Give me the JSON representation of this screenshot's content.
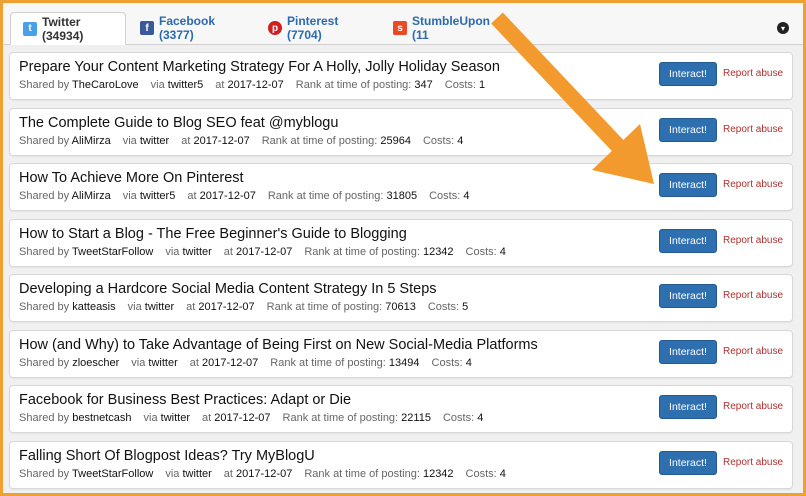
{
  "tabs": [
    {
      "label": "Twitter (34934)",
      "icon": "twitter-icon"
    },
    {
      "label": "Facebook (3377)",
      "icon": "facebook-icon"
    },
    {
      "label": "Pinterest (7704)",
      "icon": "pinterest-icon"
    },
    {
      "label": "StumbleUpon (11",
      "icon": "stumbleupon-icon"
    }
  ],
  "labels": {
    "shared_by": "Shared by",
    "via": "via",
    "at": "at",
    "rank": "Rank at time of posting:",
    "costs": "Costs:",
    "interact": "Interact!",
    "report": "Report abuse"
  },
  "rows": [
    {
      "title": "Prepare Your Content Marketing Strategy For A Holly, Jolly Holiday Season",
      "user": "TheCaroLove",
      "via": "twitter5",
      "date": "2017-12-07",
      "rank": "347",
      "cost": "1"
    },
    {
      "title": "The Complete Guide to Blog SEO feat @myblogu",
      "user": "AliMirza",
      "via": "twitter",
      "date": "2017-12-07",
      "rank": "25964",
      "cost": "4"
    },
    {
      "title": "How To Achieve More On Pinterest",
      "user": "AliMirza",
      "via": "twitter5",
      "date": "2017-12-07",
      "rank": "31805",
      "cost": "4"
    },
    {
      "title": "How to Start a Blog - The Free Beginner's Guide to Blogging",
      "user": "TweetStarFollow",
      "via": "twitter",
      "date": "2017-12-07",
      "rank": "12342",
      "cost": "4"
    },
    {
      "title": "Developing a Hardcore Social Media Content Strategy In 5 Steps",
      "user": "katteasis",
      "via": "twitter",
      "date": "2017-12-07",
      "rank": "70613",
      "cost": "5"
    },
    {
      "title": "How (and Why) to Take Advantage of Being First on New Social-Media Platforms",
      "user": "zloescher",
      "via": "twitter",
      "date": "2017-12-07",
      "rank": "13494",
      "cost": "4"
    },
    {
      "title": "Facebook for Business Best Practices: Adapt or Die",
      "user": "bestnetcash",
      "via": "twitter",
      "date": "2017-12-07",
      "rank": "22115",
      "cost": "4"
    },
    {
      "title": "Falling Short Of Blogpost Ideas? Try MyBlogU",
      "user": "TweetStarFollow",
      "via": "twitter",
      "date": "2017-12-07",
      "rank": "12342",
      "cost": "4"
    }
  ],
  "colors": {
    "frame": "#f0a030",
    "arrow": "#f39a2e",
    "button": "#2e6fb0",
    "report": "#b03030"
  }
}
